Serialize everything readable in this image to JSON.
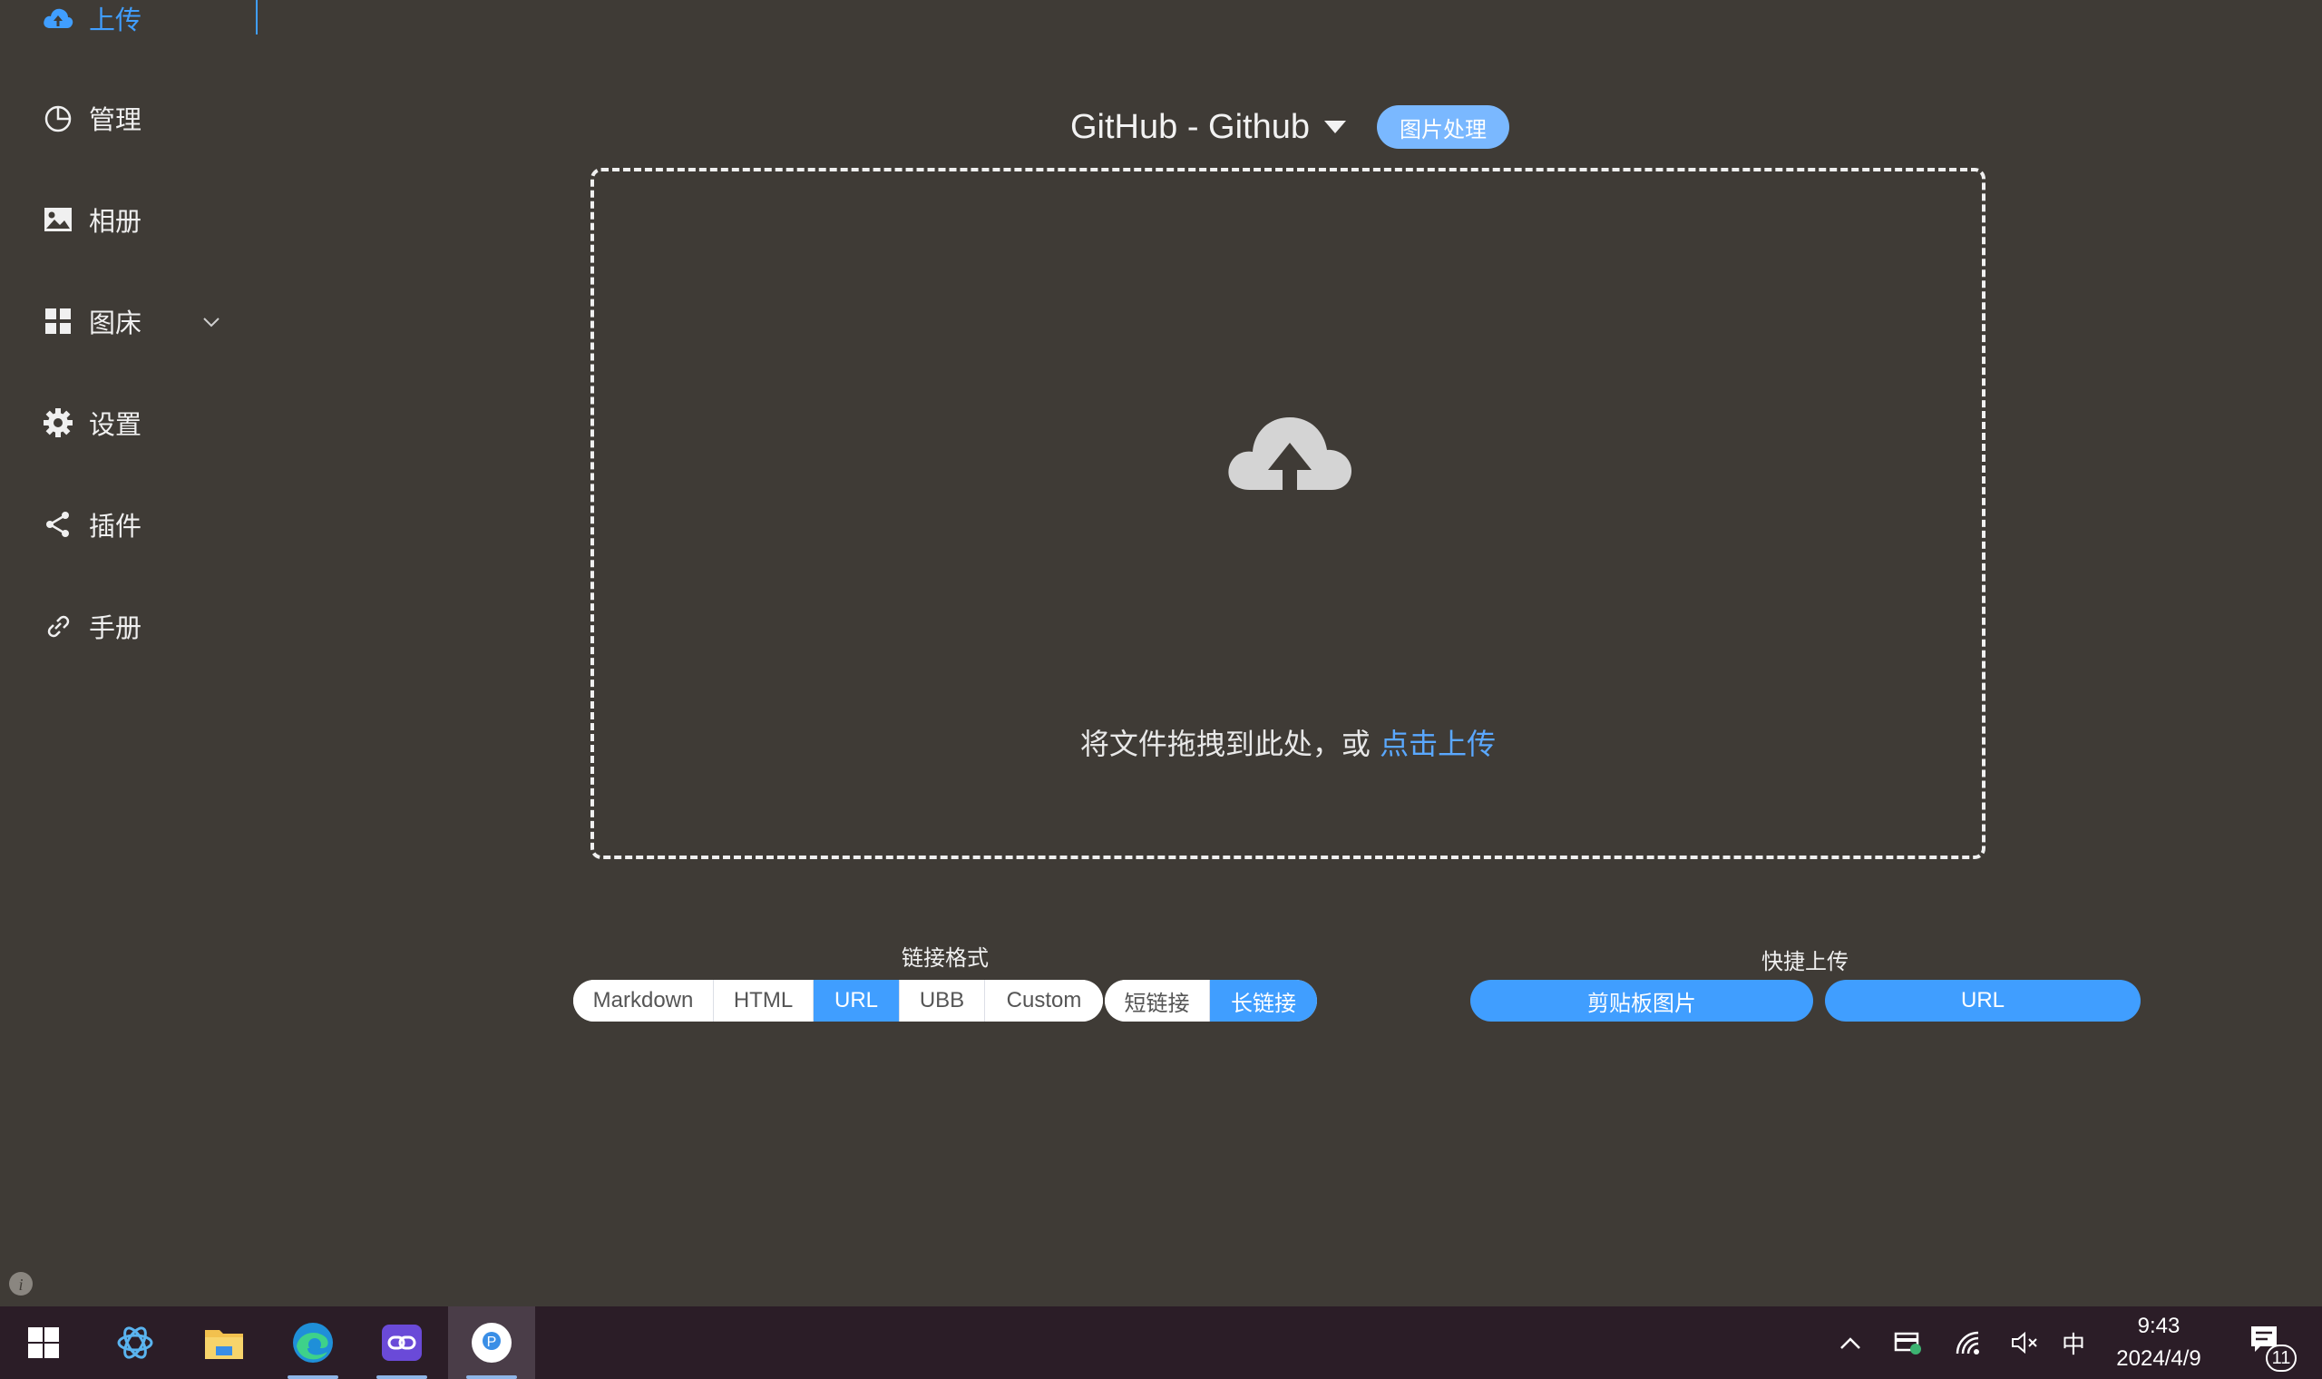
{
  "sidebar": {
    "items": [
      {
        "label": "上传",
        "icon": "cloud-upload-icon",
        "active": true
      },
      {
        "label": "管理",
        "icon": "pie-chart-icon"
      },
      {
        "label": "相册",
        "icon": "picture-icon"
      },
      {
        "label": "图床",
        "icon": "grid-icon",
        "expandable": true
      },
      {
        "label": "设置",
        "icon": "gear-icon"
      },
      {
        "label": "插件",
        "icon": "share-icon"
      },
      {
        "label": "手册",
        "icon": "link-icon"
      }
    ]
  },
  "header": {
    "picbed_title": "GitHub - Github",
    "image_process_label": "图片处理"
  },
  "dropzone": {
    "text": "将文件拖拽到此处，或 ",
    "link_text": "点击上传"
  },
  "link_format": {
    "label": "链接格式",
    "options": [
      "Markdown",
      "HTML",
      "URL",
      "UBB",
      "Custom"
    ],
    "selected": "URL",
    "length_options": [
      "短链接",
      "长链接"
    ],
    "length_selected": "长链接"
  },
  "quick_upload": {
    "label": "快捷上传",
    "buttons": [
      "剪贴板图片",
      "URL"
    ]
  },
  "taskbar": {
    "apps": [
      "windows-start-icon",
      "chatgpt-icon",
      "file-explorer-icon",
      "edge-icon",
      "link-app-icon",
      "picgo-icon"
    ],
    "tray": {
      "ime": "中",
      "time": "9:43",
      "date": "2024/4/9",
      "notification_count": "11"
    }
  },
  "colors": {
    "background": "#3f3b36",
    "accent": "#409eff",
    "taskbar": "#2b1d27"
  }
}
